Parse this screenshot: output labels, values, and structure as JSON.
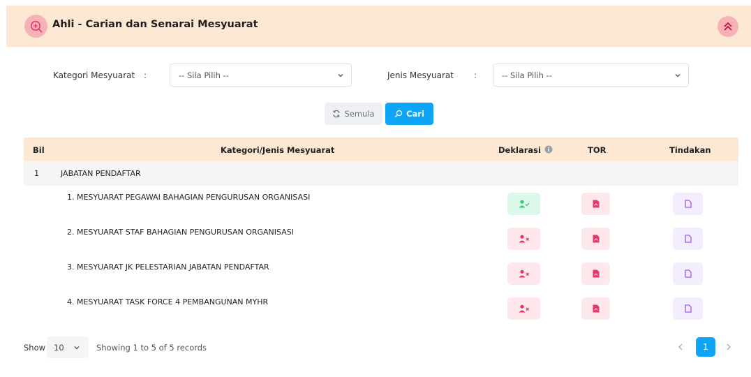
{
  "header": {
    "title": "Ahli - Carian dan Senarai Mesyuarat",
    "icon": "search-plus-icon"
  },
  "filters": {
    "kategori": {
      "label": "Kategori Mesyuarat",
      "colon": ":",
      "value": "-- Sila Pilih --"
    },
    "jenis": {
      "label": "Jenis Mesyuarat",
      "colon": ":",
      "value": "-- Sila Pilih --"
    }
  },
  "buttons": {
    "reset": "Semula",
    "search": "Cari"
  },
  "table": {
    "headers": {
      "bil": "Bil",
      "kategori": "Kategori/Jenis Mesyuarat",
      "deklarasi": "Deklarasi",
      "tor": "TOR",
      "tindakan": "Tindakan"
    },
    "group": {
      "bil": "1",
      "name": "JABATAN PENDAFTAR"
    },
    "rows": [
      {
        "name": "1. MESYUARAT PEGAWAI BAHAGIAN PENGURUSAN ORGANISASI",
        "declared": true
      },
      {
        "name": "2. MESYUARAT STAF BAHAGIAN PENGURUSAN ORGANISASI",
        "declared": false
      },
      {
        "name": "3. MESYUARAT JK PELESTARIAN JABATAN PENDAFTAR",
        "declared": false
      },
      {
        "name": "4. MESYUARAT TASK FORCE 4 PEMBANGUNAN MYHR",
        "declared": false
      }
    ]
  },
  "footer": {
    "show": "Show",
    "length": "10",
    "info": "Showing 1 to 5 of 5 records",
    "page": "1"
  },
  "colors": {
    "accent": "#0ea5f6",
    "header_bg": "#fde9d3",
    "pink": "#e8366c",
    "green": "#2ecc71",
    "purple": "#a259e8"
  }
}
